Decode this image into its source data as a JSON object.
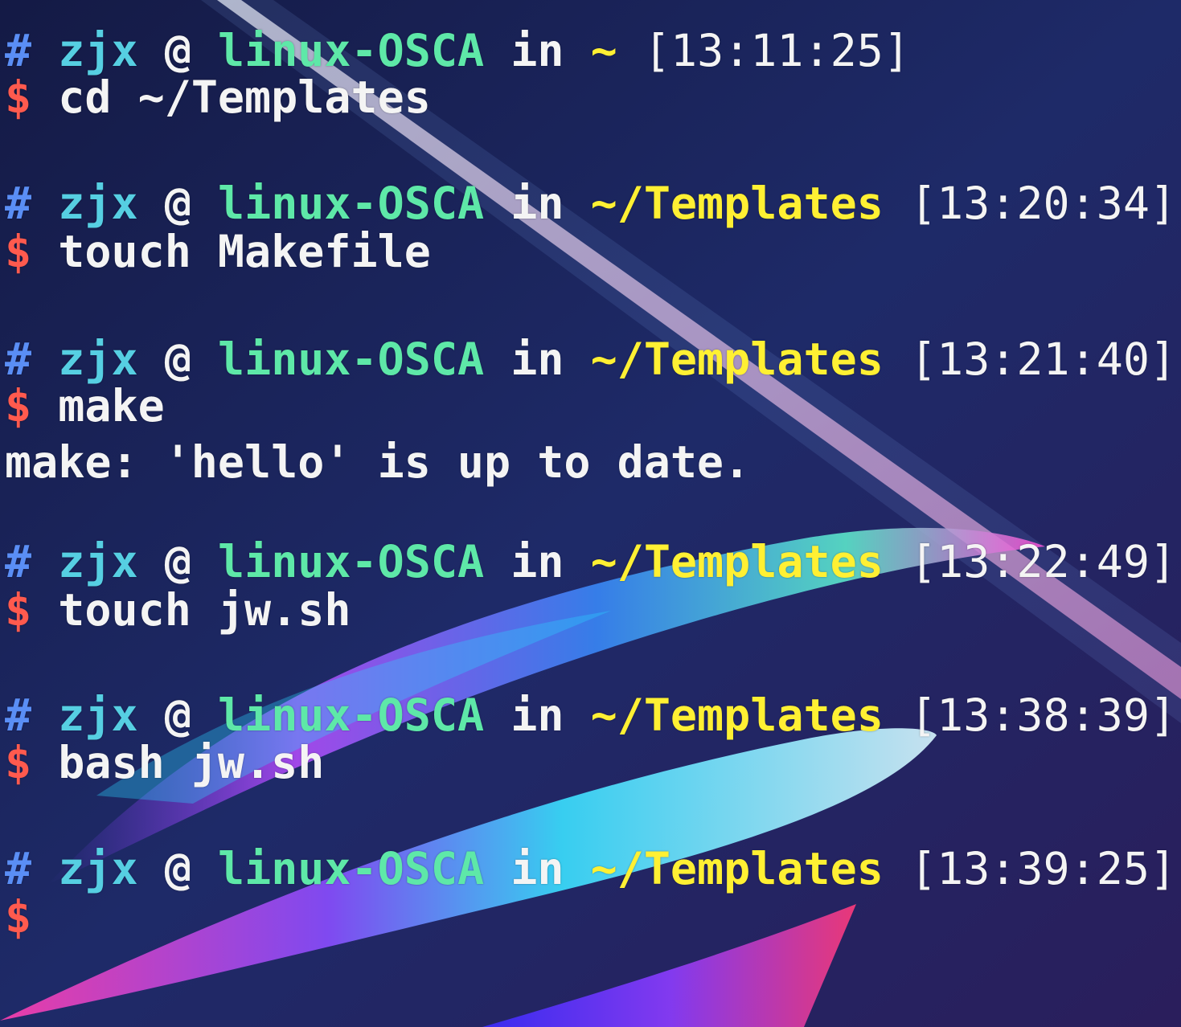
{
  "terminal": {
    "blocks": [
      {
        "prompt": {
          "hash": "#",
          "user": "zjx",
          "at": "@",
          "host": "linux-OSCA",
          "in": "in",
          "dir": "~",
          "time": "[13:11:25]"
        },
        "dollar": "$",
        "command": "cd ~/Templates"
      },
      {
        "prompt": {
          "hash": "#",
          "user": "zjx",
          "at": "@",
          "host": "linux-OSCA",
          "in": "in",
          "dir": "~/Templates",
          "time": "[13:20:34]"
        },
        "dollar": "$",
        "command": "touch Makefile"
      },
      {
        "prompt": {
          "hash": "#",
          "user": "zjx",
          "at": "@",
          "host": "linux-OSCA",
          "in": "in",
          "dir": "~/Templates",
          "time": "[13:21:40]"
        },
        "dollar": "$",
        "command": "make",
        "output": "make: 'hello' is up to date."
      },
      {
        "prompt": {
          "hash": "#",
          "user": "zjx",
          "at": "@",
          "host": "linux-OSCA",
          "in": "in",
          "dir": "~/Templates",
          "time": "[13:22:49]"
        },
        "dollar": "$",
        "command": "touch jw.sh"
      },
      {
        "prompt": {
          "hash": "#",
          "user": "zjx",
          "at": "@",
          "host": "linux-OSCA",
          "in": "in",
          "dir": "~/Templates",
          "time": "[13:38:39]"
        },
        "dollar": "$",
        "command": "bash jw.sh"
      },
      {
        "prompt": {
          "hash": "#",
          "user": "zjx",
          "at": "@",
          "host": "linux-OSCA",
          "in": "in",
          "dir": "~/Templates",
          "time": "[13:39:25]"
        },
        "dollar": "$",
        "command": ""
      }
    ]
  },
  "colors": {
    "background": "#1a2150",
    "hash": "#5a8ef5",
    "user": "#56cfe2",
    "host": "#5ee8a8",
    "dir": "#fff033",
    "dollar": "#ff5a4e",
    "text": "#f4f4f4"
  }
}
